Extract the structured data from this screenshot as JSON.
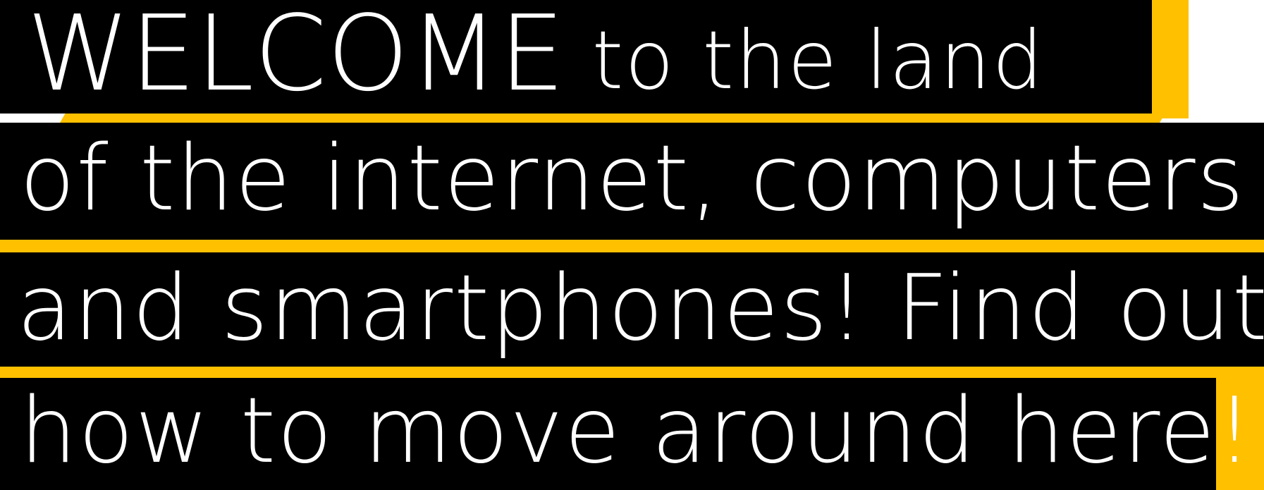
{
  "banner": {
    "line1_big": "WELCOME",
    "line1_rest": " to the land",
    "line2": "of the internet, computers",
    "line3": "and smartphones! Find out",
    "line4": "how to move around here!"
  },
  "colors": {
    "background_bar": "#000000",
    "text": "#ffffff",
    "accent": "#ffc000"
  }
}
